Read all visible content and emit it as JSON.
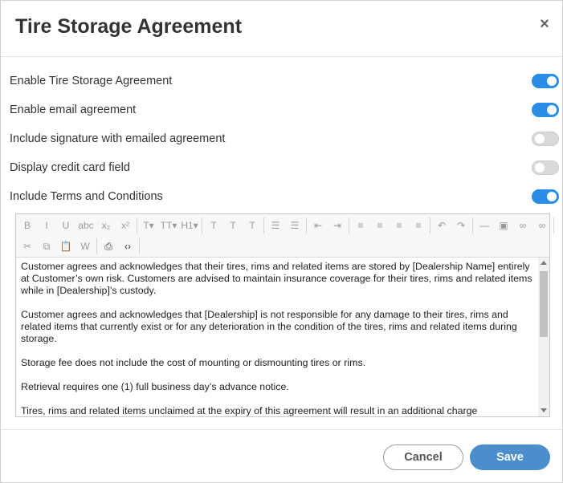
{
  "dialog": {
    "title": "Tire Storage Agreement",
    "close_icon": "×"
  },
  "toggles": [
    {
      "label": "Enable Tire Storage Agreement",
      "state": "on"
    },
    {
      "label": "Enable email agreement",
      "state": "on"
    },
    {
      "label": "Include signature with emailed agreement",
      "state": "off"
    },
    {
      "label": "Display credit card field",
      "state": "off"
    },
    {
      "label": "Include Terms and Conditions",
      "state": "on"
    }
  ],
  "toolbar": {
    "row1": [
      {
        "icon": "bold-icon",
        "glyph": "B"
      },
      {
        "icon": "italic-icon",
        "glyph": "I"
      },
      {
        "icon": "underline-icon",
        "glyph": "U"
      },
      {
        "icon": "strikethrough-icon",
        "glyph": "abc"
      },
      {
        "icon": "subscript-icon",
        "glyph": "x₂"
      },
      {
        "icon": "superscript-icon",
        "glyph": "x²"
      },
      {
        "icon": "font-name-icon",
        "glyph": "T▾"
      },
      {
        "icon": "font-size-icon",
        "glyph": "TT▾"
      },
      {
        "icon": "heading-icon",
        "glyph": "H1▾"
      },
      {
        "icon": "text-color-icon",
        "glyph": "T"
      },
      {
        "icon": "highlight-icon",
        "glyph": "T"
      },
      {
        "icon": "clear-format-icon",
        "glyph": "T"
      },
      {
        "icon": "bullet-list-icon",
        "glyph": "☰"
      },
      {
        "icon": "numbered-list-icon",
        "glyph": "☰"
      },
      {
        "icon": "outdent-icon",
        "glyph": "⇤"
      },
      {
        "icon": "indent-icon",
        "glyph": "⇥"
      },
      {
        "icon": "align-left-icon",
        "glyph": "≡"
      },
      {
        "icon": "align-center-icon",
        "glyph": "≡"
      },
      {
        "icon": "align-right-icon",
        "glyph": "≡"
      },
      {
        "icon": "align-justify-icon",
        "glyph": "≡"
      },
      {
        "icon": "undo-icon",
        "glyph": "↶"
      },
      {
        "icon": "redo-icon",
        "glyph": "↷"
      },
      {
        "icon": "horizontal-rule-icon",
        "glyph": "—"
      },
      {
        "icon": "image-icon",
        "glyph": "▣"
      },
      {
        "icon": "link-icon",
        "glyph": "∞"
      },
      {
        "icon": "unlink-icon",
        "glyph": "∞"
      }
    ],
    "row2": [
      {
        "icon": "cut-icon",
        "glyph": "✂"
      },
      {
        "icon": "copy-icon",
        "glyph": "⧉"
      },
      {
        "icon": "paste-icon",
        "glyph": "📋"
      },
      {
        "icon": "paste-word-icon",
        "glyph": "W"
      },
      {
        "icon": "print-icon",
        "glyph": "⎙"
      },
      {
        "icon": "source-code-icon",
        "glyph": "‹›"
      }
    ]
  },
  "editor": {
    "paragraphs": [
      "Customer agrees and acknowledges that their tires, rims and related items are stored by [Dealership Name] entirely at Customer’s own risk. Customers are advised to maintain insurance coverage for their tires, rims and related items while in [Dealership]’s custody.",
      "Customer agrees and acknowledges that [Dealership] is not responsible for any damage to their tires, rims and related items that currently exist or for any deterioration in the condition of the tires, rims and related items during storage.",
      "Storage fee does not include the cost of mounting or dismounting tires or rims.",
      "Retrieval requires one (1) full business day’s advance notice.",
      "Tires, rims and related items unclaimed at the expiry of this agreement will result in an additional charge"
    ]
  },
  "footer": {
    "cancel_label": "Cancel",
    "save_label": "Save"
  },
  "colors": {
    "toggle_on": "#2b8ce6",
    "toggle_off": "#d9d9d9",
    "save_button": "#4a8fcc"
  }
}
